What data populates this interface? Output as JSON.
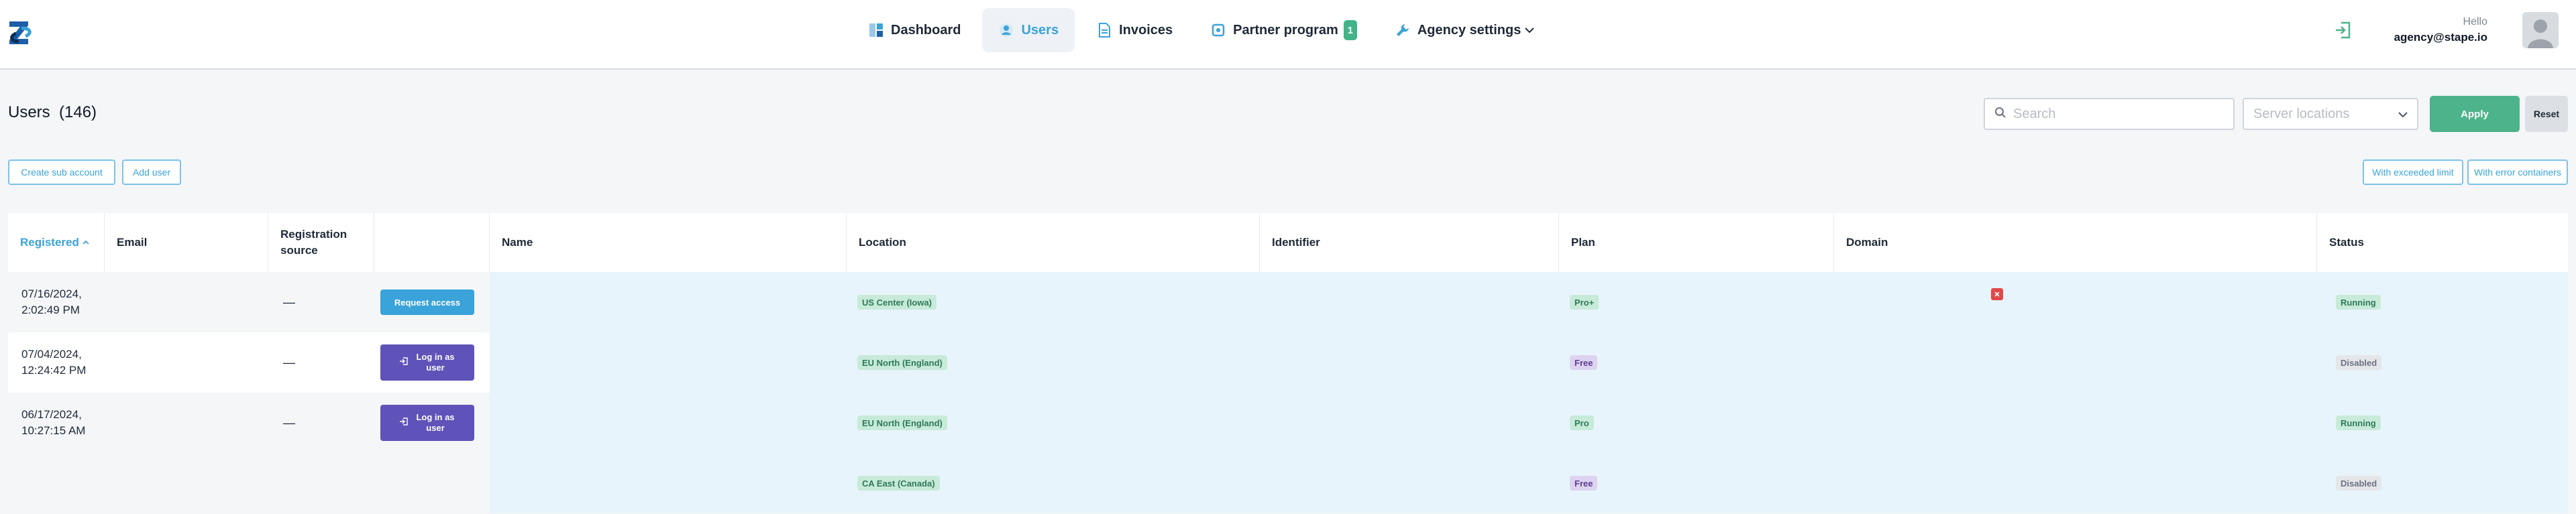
{
  "header": {
    "nav": [
      {
        "label": "Dashboard",
        "icon": "dashboard-icon",
        "active": false
      },
      {
        "label": "Users",
        "icon": "users-icon",
        "active": true
      },
      {
        "label": "Invoices",
        "icon": "invoice-icon",
        "active": false
      },
      {
        "label": "Partner program",
        "icon": "partner-icon",
        "badge": "1",
        "active": false
      },
      {
        "label": "Agency settings",
        "icon": "wrench-icon",
        "active": false,
        "dropdown": true
      }
    ],
    "user": {
      "hello": "Hello",
      "email": "agency@stape.io"
    }
  },
  "toolbar": {
    "title": "Users  (146)",
    "search_placeholder": "Search",
    "locations_placeholder": "Server locations",
    "apply_label": "Apply",
    "reset_label": "Reset",
    "create_sub_account": "Create sub account",
    "add_user": "Add user",
    "with_exceeded_limit": "With exceeded limit",
    "with_error_containers": "With error containers"
  },
  "table": {
    "columns": [
      "Registered",
      "Email",
      "Registration source",
      "",
      "Name",
      "Location",
      "Identifier",
      "Plan",
      "Domain",
      "Status"
    ],
    "sort_indicator": "^",
    "rows": [
      {
        "registered": "07/16/2024,\n2:02:49 PM",
        "source": "—",
        "action": "Request access",
        "location": "US Center (Iowa)",
        "plan": "Pro+",
        "status": "Running",
        "domain_error": true
      },
      {
        "registered": "07/04/2024,\n12:24:42 PM",
        "source": "—",
        "action": "Log in as user",
        "location": "EU North (England)",
        "plan": "Free",
        "status": "Disabled",
        "domain_error": false
      },
      {
        "registered": "06/17/2024,\n10:27:15 AM",
        "source": "—",
        "action": "Log in as user",
        "location": "EU North (England)",
        "plan": "Pro",
        "status": "Running",
        "domain_error": false
      },
      {
        "registered": "",
        "source": "",
        "action": "",
        "location": "CA East (Canada)",
        "plan": "Free",
        "status": "Disabled",
        "domain_error": false
      }
    ]
  },
  "colors": {
    "accent": "#3aa3d9",
    "apply": "#4db38a",
    "login": "#5f52b8",
    "row_highlight": "#e8f4fb"
  }
}
